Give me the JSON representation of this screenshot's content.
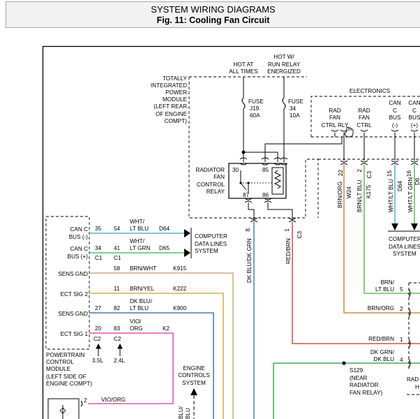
{
  "header": {
    "title": "SYSTEM WIRING DIAGRAMS",
    "subtitle": "Fig. 11: Cooling Fan Circuit"
  },
  "colors": {
    "wht_lt_blu": "#3aa6c8",
    "wht_lt_grn": "#3cb043",
    "brn_wht": "#c89b63",
    "brn_yel": "#c8a21c",
    "dk_blu_lt_blu": "#1e5fa8",
    "vio_org": "#e0309a",
    "red_brn": "#cf2b2b",
    "dk_grn_dk_blu": "#1a9a3a",
    "brn_org": "#c8781e",
    "brn_lt_blu": "#4cae3c",
    "dk_blu_dk_grn": "#2a6fb4"
  },
  "tipm": {
    "label": [
      "TOTALLY",
      "INTEGRATED",
      "POWER",
      "MODULE",
      "(LEFT REAR",
      "OF ENGINE",
      "COMPT)"
    ],
    "hot_at_all_times": [
      "HOT AT",
      "ALL TIMES"
    ],
    "hot_run_relay": [
      "HOT W/",
      "RUN RELAY",
      "ENERGIZED"
    ],
    "fuse_j19": [
      "FUSE",
      "J19",
      "60A"
    ],
    "fuse_34": [
      "FUSE",
      "34",
      "10A"
    ],
    "relay_label": [
      "RADIATOR",
      "FAN",
      "CONTROL",
      "RELAY"
    ],
    "relay_pins": [
      "30",
      "85",
      "87",
      "86"
    ],
    "electronics": "ELECTRONICS",
    "rad_fan_ctrl_rly": [
      "RAD",
      "FAN",
      "CTRL RLY"
    ],
    "rad_fan_ctrl": [
      "RAD",
      "FAN",
      "CTRL"
    ],
    "can_c_bus_minus": [
      "CAN",
      "C",
      "BUS",
      "(-)"
    ],
    "can_c_bus_plus": [
      "CAN",
      "C",
      "BUS",
      "(+)"
    ],
    "cavity_8": "8",
    "cavity_1": "1",
    "conn_c3": "C3",
    "cavity_22": "22",
    "cavity_2": "2",
    "conn_c3_b": "C3",
    "cavity_15": "15",
    "cavity_16": "16"
  },
  "pcm": {
    "label": [
      "POWERTRAIN",
      "CONTROL",
      "MODULE",
      "(LEFT SIDE OF",
      "ENGINE COMPT)"
    ],
    "rows": [
      {
        "name": "CAN C",
        "sub": "BUS (-)",
        "pin1": "35",
        "pin2": "54",
        "color_name": "WHT/",
        "color_name2": "LT BLU",
        "circuit": "D64"
      },
      {
        "name": "CAN C",
        "sub": "BUS (+)",
        "pin1": "34",
        "pin2": "41",
        "color_name": "WHT/",
        "color_name2": "LT GRN",
        "circuit": "D65"
      },
      {
        "name": "SENS GND",
        "pin2": "58",
        "color_name": "BRN/WHT",
        "circuit": "K915"
      },
      {
        "name": "ECT SIG 2",
        "pin2": "11",
        "color_name": "BRN/YEL",
        "circuit": "K222"
      },
      {
        "name": "SENS GND",
        "pin1": "27",
        "pin2": "82",
        "color_name": "DK BLU/",
        "color_name2": "LT BLU",
        "circuit": "K900"
      },
      {
        "name": "ECT SIG 1",
        "pin1": "20",
        "pin2": "83",
        "color_name": "VIO/",
        "color_name2": "ORG",
        "circuit": "K2"
      }
    ],
    "conn_c1": "C1",
    "conn_c1_b": "C1",
    "conn_c2": "C2",
    "conn_c2_b": "C2",
    "engine_35": "3.5L",
    "engine_24": "2.4L"
  },
  "cdl_left": [
    "COMPUTER",
    "DATA LINES",
    "SYSTEM"
  ],
  "cdl_right": [
    "COMPUTER",
    "DATA LINES",
    "SYSTEM"
  ],
  "engine_controls": [
    "ENGINE",
    "CONTROLS",
    "SYSTEM"
  ],
  "wire_labels": {
    "dk_blu_dk_grn": "DK BLU/DK GRN",
    "red_brn": "RED/BRN",
    "brn_org": "BRN/ORG",
    "w24": "W24",
    "brn_lt_blu": "BRN/LT BLU",
    "k175": "K175",
    "wht_lt_blu": "WHT/LT BLU",
    "d64": "D64",
    "wht_lt_grn": "WHT/LT GRN",
    "d65_partial": "D6",
    "brn_lt_blu_r1": "BRN/",
    "brn_lt_blu_r2": "LT BLU",
    "brn_org_r": "BRN/ORG",
    "red_brn_r": "RED/BRN",
    "dk_grn_r1": "DK GRN/",
    "dk_grn_r2": "DK BLU",
    "vio_org_bottom": "VIO/ORG",
    "blu_partial": "BLU/",
    "blu_partial2": "BLU"
  },
  "right_pins": [
    "5",
    "2",
    "1",
    "4"
  ],
  "splice": [
    "S129",
    "(NEAR",
    "RADIATOR",
    "FAN RELAY)"
  ],
  "rad_partial": [
    "RAD",
    "H"
  ],
  "sensor_pin": "2"
}
